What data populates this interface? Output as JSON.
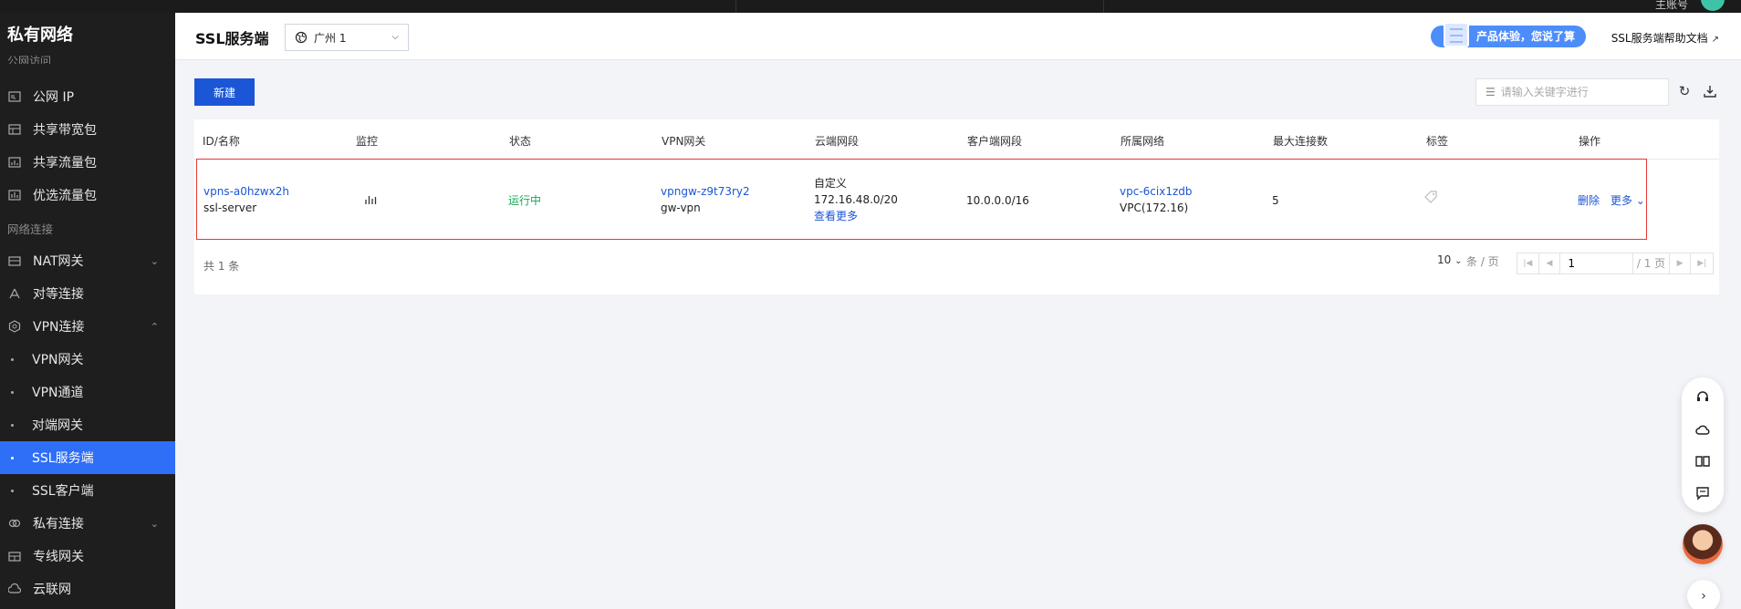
{
  "topbar": {
    "user_label": "主账号"
  },
  "sidebar": {
    "brand": "私有网络",
    "partial_group": "公网访问",
    "items": [
      {
        "label": "公网 IP",
        "icon": "ip-icon"
      },
      {
        "label": "共享带宽包",
        "icon": "bandwidth-icon"
      },
      {
        "label": "共享流量包",
        "icon": "traffic-icon"
      },
      {
        "label": "优选流量包",
        "icon": "premium-traffic-icon"
      }
    ],
    "group2": "网络连接",
    "items2": [
      {
        "label": "NAT网关",
        "icon": "nat-icon",
        "chevron": "down"
      },
      {
        "label": "对等连接",
        "icon": "peering-icon"
      },
      {
        "label": "VPN连接",
        "icon": "vpn-icon",
        "chevron": "up"
      }
    ],
    "vpn_sub": [
      {
        "label": "VPN网关",
        "active": false
      },
      {
        "label": "VPN通道",
        "active": false
      },
      {
        "label": "对端网关",
        "active": false
      },
      {
        "label": "SSL服务端",
        "active": true
      },
      {
        "label": "SSL客户端",
        "active": false
      }
    ],
    "items3": [
      {
        "label": "私有连接",
        "icon": "private-link-icon",
        "chevron": "down"
      },
      {
        "label": "专线网关",
        "icon": "dc-gateway-icon"
      },
      {
        "label": "云联网",
        "icon": "ccn-icon"
      }
    ]
  },
  "header": {
    "title": "SSL服务端",
    "region": "广州 1",
    "promo": "产品体验，您说了算",
    "help": "SSL服务端帮助文档"
  },
  "toolbar": {
    "new_label": "新建",
    "search_placeholder": "请输入关键字进行"
  },
  "table": {
    "columns": [
      "ID/名称",
      "监控",
      "状态",
      "VPN网关",
      "云端网段",
      "客户端网段",
      "所属网络",
      "最大连接数",
      "标签",
      "操作"
    ],
    "rows": [
      {
        "id": "vpns-a0hzwx2h",
        "name": "ssl-server",
        "status": "运行中",
        "vpn_gateway_id": "vpngw-z9t73ry2",
        "vpn_gateway_name": "gw-vpn",
        "cloud_cidr_mode": "自定义",
        "cloud_cidr": "172.16.48.0/20",
        "cloud_cidr_more": "查看更多",
        "client_cidr": "10.0.0.0/16",
        "vpc_id": "vpc-6cix1zdb",
        "vpc_name": "VPC(172.16)",
        "max_connections": "5",
        "action_delete": "删除",
        "action_more": "更多"
      }
    ],
    "total": "共 1 条"
  },
  "pagination": {
    "page_size": "10",
    "per_page_label": "条 / 页",
    "page": "1",
    "total_pages": "/ 1 页"
  }
}
